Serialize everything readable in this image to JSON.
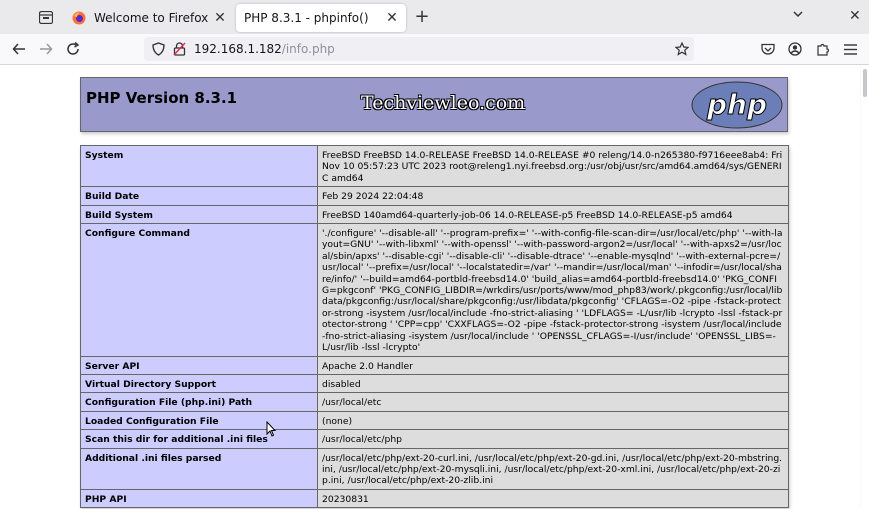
{
  "browser": {
    "tabs": [
      {
        "title": "Welcome to Firefox",
        "active": false
      },
      {
        "title": "PHP 8.3.1 - phpinfo()",
        "active": true
      }
    ],
    "url_host": "192.168.1.182",
    "url_path": "/info.php"
  },
  "page": {
    "title": "PHP Version 8.3.1",
    "watermark": "Techviewleo.com",
    "logo_text": "php",
    "rows": [
      {
        "key": "System",
        "value": "FreeBSD FreeBSD 14.0-RELEASE FreeBSD 14.0-RELEASE #0 releng/14.0-n265380-f9716eee8ab4: Fri Nov 10 05:57:23 UTC 2023 root@releng1.nyi.freebsd.org:/usr/obj/usr/src/amd64.amd64/sys/GENERIC amd64"
      },
      {
        "key": "Build Date",
        "value": "Feb 29 2024 22:04:48"
      },
      {
        "key": "Build System",
        "value": "FreeBSD 140amd64-quarterly-job-06 14.0-RELEASE-p5 FreeBSD 14.0-RELEASE-p5 amd64"
      },
      {
        "key": "Configure Command",
        "value": "'./configure' '--disable-all' '--program-prefix=' '--with-config-file-scan-dir=/usr/local/etc/php' '--with-layout=GNU' '--with-libxml' '--with-openssl' '--with-password-argon2=/usr/local' '--with-apxs2=/usr/local/sbin/apxs' '--disable-cgi' '--disable-cli' '--disable-dtrace' '--enable-mysqlnd' '--with-external-pcre=/usr/local' '--prefix=/usr/local' '--localstatedir=/var' '--mandir=/usr/local/man' '--infodir=/usr/local/share/info/' '--build=amd64-portbld-freebsd14.0' 'build_alias=amd64-portbld-freebsd14.0' 'PKG_CONFIG=pkgconf' 'PKG_CONFIG_LIBDIR=/wrkdirs/usr/ports/www/mod_php83/work/.pkgconfig:/usr/local/libdata/pkgconfig:/usr/local/share/pkgconfig:/usr/libdata/pkgconfig' 'CFLAGS=-O2 -pipe -fstack-protector-strong -isystem /usr/local/include -fno-strict-aliasing ' 'LDFLAGS= -L/usr/lib -lcrypto -lssl -fstack-protector-strong ' 'CPP=cpp' 'CXXFLAGS=-O2 -pipe -fstack-protector-strong -isystem /usr/local/include -fno-strict-aliasing -isystem /usr/local/include ' 'OPENSSL_CFLAGS=-I/usr/include' 'OPENSSL_LIBS=-L/usr/lib -lssl -lcrypto'"
      },
      {
        "key": "Server API",
        "value": "Apache 2.0 Handler"
      },
      {
        "key": "Virtual Directory Support",
        "value": "disabled"
      },
      {
        "key": "Configuration File (php.ini) Path",
        "value": "/usr/local/etc"
      },
      {
        "key": "Loaded Configuration File",
        "value": "(none)"
      },
      {
        "key": "Scan this dir for additional .ini files",
        "value": "/usr/local/etc/php"
      },
      {
        "key": "Additional .ini files parsed",
        "value": "/usr/local/etc/php/ext-20-curl.ini, /usr/local/etc/php/ext-20-gd.ini, /usr/local/etc/php/ext-20-mbstring.ini, /usr/local/etc/php/ext-20-mysqli.ini, /usr/local/etc/php/ext-20-xml.ini, /usr/local/etc/php/ext-20-zip.ini, /usr/local/etc/php/ext-20-zlib.ini"
      },
      {
        "key": "PHP API",
        "value": "20230831"
      }
    ]
  },
  "icons": {
    "tab_list": "tab-list-icon",
    "firefox": "firefox-icon",
    "back": "back-arrow-icon",
    "forward": "forward-arrow-icon",
    "reload": "reload-icon",
    "shield": "tracking-shield-icon",
    "insecure": "insecure-lock-icon",
    "bookmark": "bookmark-star-icon",
    "pocket": "pocket-icon",
    "account": "account-icon",
    "extensions": "extensions-icon",
    "menu": "hamburger-menu-icon"
  },
  "colors": {
    "php_header": "#9999cc",
    "key_cell": "#ccccff",
    "value_cell": "#dddddd"
  }
}
